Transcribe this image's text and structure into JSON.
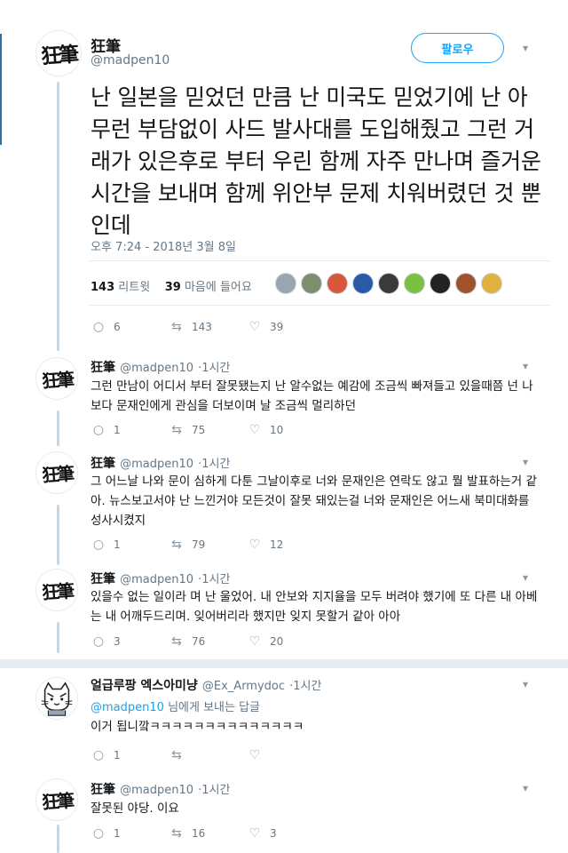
{
  "main": {
    "name": "狂筆",
    "handle": "@madpen10",
    "follow_label": "팔로우",
    "text": "난 일본을 믿었던 만큼 난 미국도 믿었기에 난 아무런 부담없이 사드 발사대를 도입해줬고 그런 거래가 있은후로 부터 우린 함께 자주 만나며 즐거운 시간을 보내며 함께 위안부 문제 치워버렸던 것 뿐인데",
    "timestamp": "오후 7:24 - 2018년 3월 8일",
    "retweets_count": "143",
    "retweets_label": "리트윗",
    "likes_count": "39",
    "likes_label": "마음에 들어요",
    "reply_count": "6",
    "retweet_count": "143",
    "like_count": "39",
    "liker_colors": [
      "#9aa5b1",
      "#7f8c6e",
      "#d9573b",
      "#2b59a8",
      "#3a3a3a",
      "#7ac142",
      "#222222",
      "#a0522d",
      "#e0b040"
    ]
  },
  "replies": [
    {
      "name": "狂筆",
      "handle": "@madpen10",
      "time": "·1시간",
      "text": "그런 만남이 어디서 부터 잘못됐는지 난 알수없는 예감에 조금씩 빠져들고 있을때쯤 넌 나보다 문재인에게 관심을 더보이며 날 조금씩 멀리하던",
      "reply_count": "1",
      "retweet_count": "75",
      "like_count": "10"
    },
    {
      "name": "狂筆",
      "handle": "@madpen10",
      "time": "·1시간",
      "text": "그 어느날 나와 문이 심하게 다툰 그날이후로 너와 문재인은 연락도 않고 뭘 발표하는거 같아. 뉴스보고서야 난 느낀거야 모든것이 잘못 돼있는걸 너와 문재인은 어느새 북미대화를 성사시켰지",
      "reply_count": "1",
      "retweet_count": "79",
      "like_count": "12"
    },
    {
      "name": "狂筆",
      "handle": "@madpen10",
      "time": "·1시간",
      "text": "있을수 없는 일이라 며 난 울었어. 내 안보와 지지율을 모두 버려야 했기에 또 다른 내 아베는 내 어깨두드리며. 잊어버리라 했지만 잊지 못할거 같아 아아",
      "reply_count": "3",
      "retweet_count": "76",
      "like_count": "20"
    }
  ],
  "conversation": [
    {
      "name": "얼급루팡 엑스아미냥",
      "handle": "@Ex_Armydoc",
      "time": "·1시간",
      "mention": "@madpen10",
      "reply_to_label": "님에게 보내는 답글",
      "text": "이거 됩니깤ㅋㅋㅋㅋㅋㅋㅋㅋㅋㅋㅋㅋㅋㅋ",
      "reply_count": "1",
      "retweet_count": "",
      "like_count": ""
    },
    {
      "name": "狂筆",
      "handle": "@madpen10",
      "time": "·1시간",
      "text": "잘못된 야당. 이요",
      "reply_count": "1",
      "retweet_count": "16",
      "like_count": "3"
    }
  ],
  "icons": {
    "reply": "reply-icon",
    "retweet": "retweet-icon",
    "like": "heart-icon",
    "more": "chevron-down-icon"
  },
  "colors": {
    "accent": "#1da1f2",
    "muted": "#657786",
    "thread_line": "#c9d6e0"
  }
}
